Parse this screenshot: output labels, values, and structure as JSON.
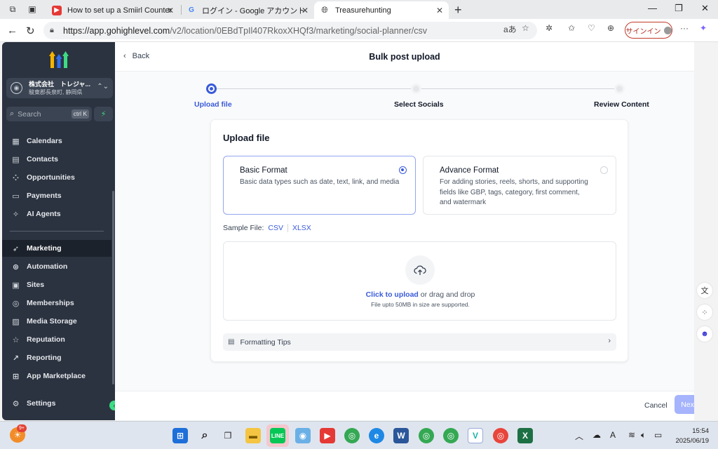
{
  "browser": {
    "tabs": [
      {
        "title": "How to set up a Smiirl Counter for",
        "favicon": "youtube-icon"
      },
      {
        "title": "ログイン - Google アカウント",
        "favicon": "google-icon"
      },
      {
        "title": "Treasurehunting",
        "favicon": "globe-icon",
        "active": true
      }
    ],
    "url_host": "https://app.gohighlevel.com",
    "url_path": "/v2/location/0EBdTpIl407RkoxXHQf3/marketing/social-planner/csv",
    "read_aloud": "aあ",
    "signin_label": "サインイン"
  },
  "sidebar": {
    "account_name": "株式会社　トレジャ...",
    "account_location": "駿東郡長泉町, 静岡県",
    "search_placeholder": "Search",
    "search_shortcut": "ctrl K",
    "items": [
      {
        "label": "Calendars",
        "icon": "calendar-icon"
      },
      {
        "label": "Contacts",
        "icon": "contacts-icon"
      },
      {
        "label": "Opportunities",
        "icon": "opportunities-icon"
      },
      {
        "label": "Payments",
        "icon": "payments-icon"
      },
      {
        "label": "AI Agents",
        "icon": "ai-agents-icon"
      },
      {
        "label": "Marketing",
        "icon": "marketing-icon",
        "active": true
      },
      {
        "label": "Automation",
        "icon": "automation-icon"
      },
      {
        "label": "Sites",
        "icon": "sites-icon"
      },
      {
        "label": "Memberships",
        "icon": "memberships-icon"
      },
      {
        "label": "Media Storage",
        "icon": "media-storage-icon"
      },
      {
        "label": "Reputation",
        "icon": "reputation-icon"
      },
      {
        "label": "Reporting",
        "icon": "reporting-icon"
      },
      {
        "label": "App Marketplace",
        "icon": "app-marketplace-icon"
      }
    ],
    "settings_label": "Settings"
  },
  "header": {
    "back_label": "Back",
    "title": "Bulk post upload"
  },
  "steps": [
    {
      "label": "Upload file",
      "active": true
    },
    {
      "label": "Select Socials",
      "active": false
    },
    {
      "label": "Review Content",
      "active": false
    }
  ],
  "card": {
    "title": "Upload file",
    "formats": [
      {
        "title": "Basic Format",
        "description": "Basic data types such as date, text, link, and media",
        "selected": true
      },
      {
        "title": "Advance Format",
        "description": "For adding stories, reels, shorts, and supporting fields like GBP, tags, category, first comment, and watermark",
        "selected": false
      }
    ],
    "sample_label": "Sample File:",
    "sample_links": [
      "CSV",
      "XLSX"
    ],
    "upload_link": "Click to upload",
    "upload_text": " or drag and drop",
    "upload_note": "File upto 50MB in size are supported.",
    "tips_label": "Formatting Tips"
  },
  "footer": {
    "cancel_label": "Cancel",
    "next_label": "Next"
  },
  "taskbar": {
    "time": "15:54",
    "date": "2025/06/19",
    "notification_badge": "9+"
  },
  "colors": {
    "accent": "#3a5bd9",
    "sidebar_bg": "#2b3340",
    "next_disabled": "#a5b4fc"
  }
}
